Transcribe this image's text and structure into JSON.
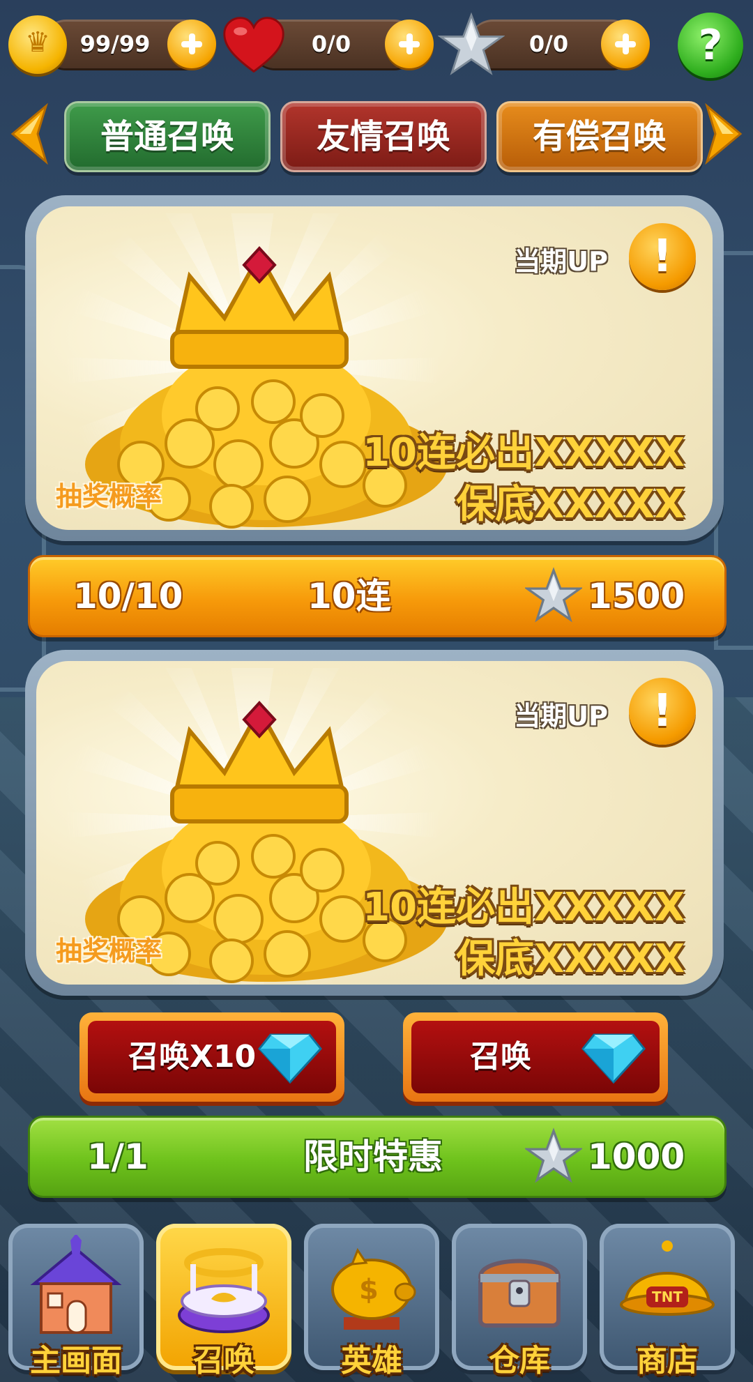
{
  "top_bar": {
    "crown_value": "99/99",
    "hearts_value": "0/0",
    "stars_value": "0/0",
    "help_glyph": "?"
  },
  "tabs": [
    {
      "label": "普通召唤"
    },
    {
      "label": "友情召唤"
    },
    {
      "label": "有偿召唤"
    }
  ],
  "banners": [
    {
      "up_label": "当期UP",
      "info_glyph": "!",
      "promo_line1": "10连必出XXXXX",
      "promo_line2": "保底XXXXX",
      "odds_label": "抽奖概率"
    },
    {
      "up_label": "当期UP",
      "info_glyph": "!",
      "promo_line1": "10连必出XXXXX",
      "promo_line2": "保底XXXXX",
      "odds_label": "抽奖概率"
    }
  ],
  "ten_pull_bar": {
    "count": "10/10",
    "label": "10连",
    "price": "1500"
  },
  "summon_buttons": {
    "multi_label": "召唤X10",
    "single_label": "召唤"
  },
  "offer_bar": {
    "count": "1/1",
    "label": "限时特惠",
    "price": "1000"
  },
  "bottom_nav": [
    {
      "label": "主画面",
      "icon": "house-icon"
    },
    {
      "label": "召唤",
      "icon": "summon-altar-icon",
      "active": true
    },
    {
      "label": "英雄",
      "icon": "piggy-bank-icon"
    },
    {
      "label": "仓库",
      "icon": "treasure-chest-icon"
    },
    {
      "label": "商店",
      "icon": "shop-bell-icon"
    }
  ],
  "colors": {
    "tab_green": "#2f7f3a",
    "tab_red": "#9b2820",
    "tab_orange": "#d47512",
    "bar_orange": "#f79a0a",
    "bar_green": "#6ec21c",
    "accent_gold": "#ffd23a"
  }
}
